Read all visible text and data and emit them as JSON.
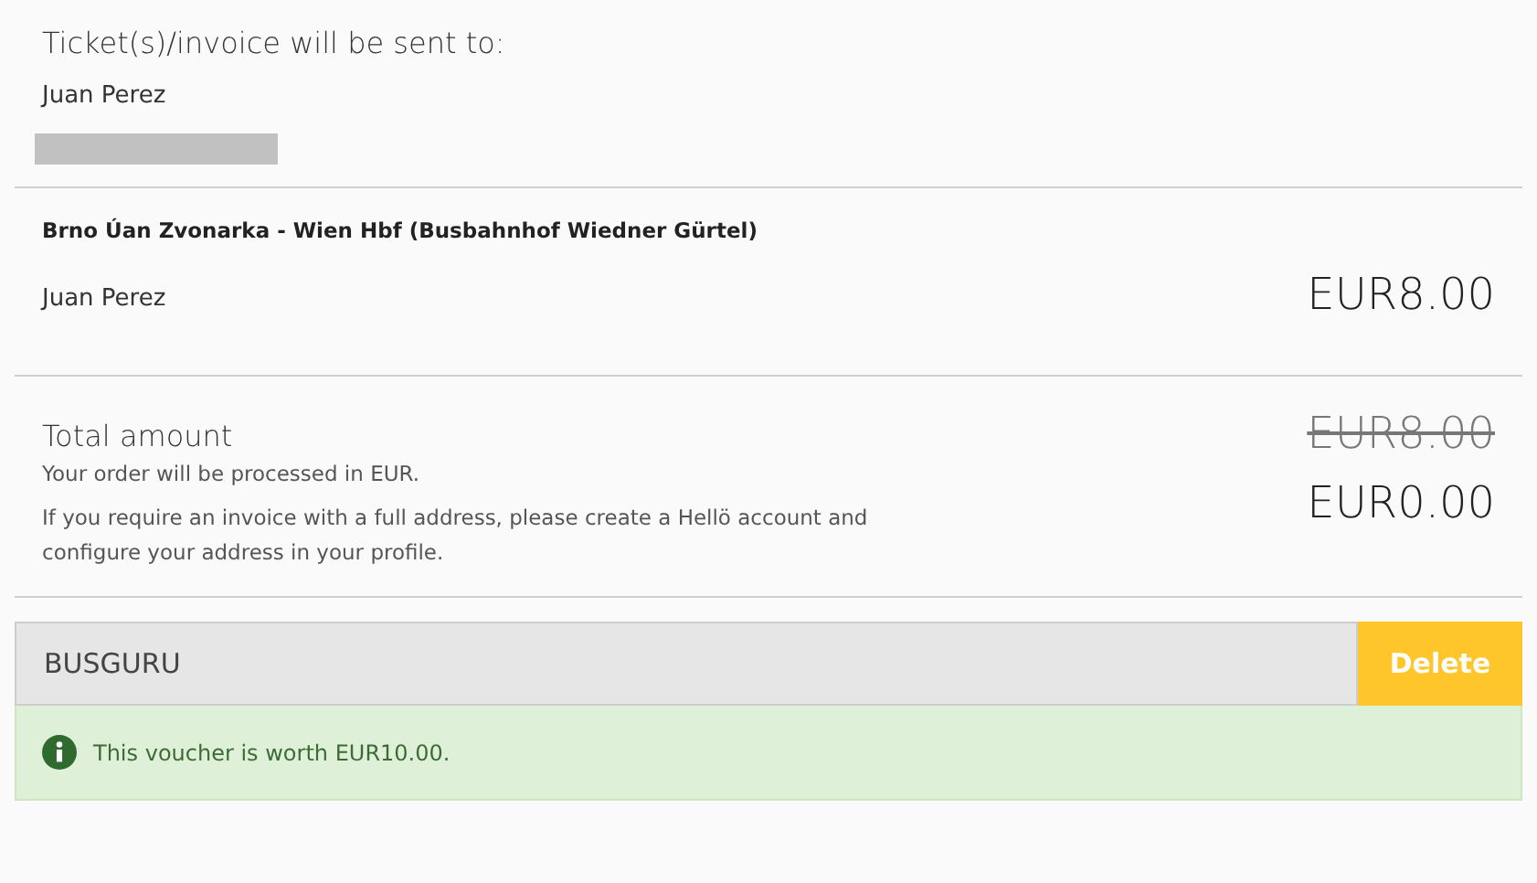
{
  "recipient": {
    "heading": "Ticket(s)/invoice will be sent to:",
    "name": "Juan Perez"
  },
  "trip": {
    "route": "Brno Úan Zvonarka - Wien Hbf (Busbahnhof Wiedner Gürtel)",
    "passenger": "Juan Perez",
    "price": "EUR8.00"
  },
  "total": {
    "label": "Total amount",
    "note": "Your order will be processed in EUR.",
    "invoice_note": "If you require an invoice with a full address, please create a Hellö account and configure your address in your profile.",
    "old_price": "EUR8.00",
    "price": "EUR0.00"
  },
  "voucher": {
    "value": "BUSGURU",
    "button": "Delete",
    "message": "This voucher is worth EUR10.00."
  }
}
